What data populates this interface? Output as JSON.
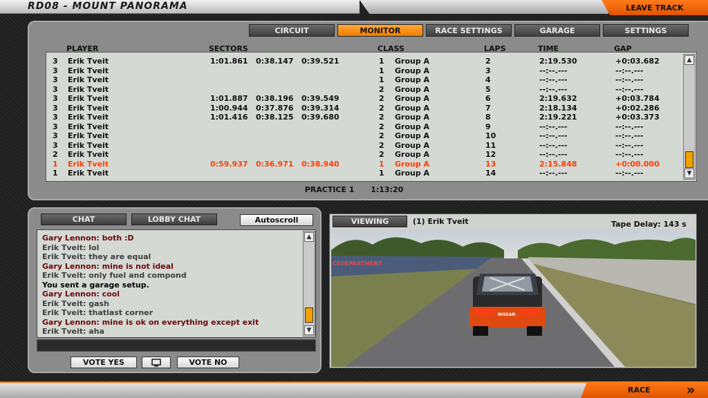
{
  "header": {
    "title": "RD08 - MOUNT PANORAMA",
    "leave_label": "LEAVE TRACK"
  },
  "tabs": [
    {
      "label": "CIRCUIT",
      "active": false
    },
    {
      "label": "MONITOR",
      "active": true
    },
    {
      "label": "RACE SETTINGS",
      "active": false
    },
    {
      "label": "GARAGE",
      "active": false
    },
    {
      "label": "SETTINGS",
      "active": false
    }
  ],
  "columns": {
    "player": "PLAYER",
    "sectors": "SECTORS",
    "class": "CLASS",
    "laps": "LAPS",
    "time": "TIME",
    "gap": "GAP"
  },
  "rows": [
    {
      "pos": "3",
      "player": "Erik Tveit",
      "s1": "1:01.861",
      "s2": "0:38.147",
      "s3": "0:39.521",
      "cls_no": "1",
      "cls": "Group A",
      "lap": "2",
      "time": "2:19.530",
      "gap": "+0:03.682",
      "hl": false
    },
    {
      "pos": "3",
      "player": "Erik Tveit",
      "s1": "",
      "s2": "",
      "s3": "",
      "cls_no": "1",
      "cls": "Group A",
      "lap": "3",
      "time": "--:--.---",
      "gap": "--:--.---",
      "hl": false
    },
    {
      "pos": "3",
      "player": "Erik Tveit",
      "s1": "",
      "s2": "",
      "s3": "",
      "cls_no": "1",
      "cls": "Group A",
      "lap": "4",
      "time": "--:--.---",
      "gap": "--:--.---",
      "hl": false
    },
    {
      "pos": "3",
      "player": "Erik Tveit",
      "s1": "",
      "s2": "",
      "s3": "",
      "cls_no": "2",
      "cls": "Group A",
      "lap": "5",
      "time": "--:--.---",
      "gap": "--:--.---",
      "hl": false
    },
    {
      "pos": "3",
      "player": "Erik Tveit",
      "s1": "1:01.887",
      "s2": "0:38.196",
      "s3": "0:39.549",
      "cls_no": "2",
      "cls": "Group A",
      "lap": "6",
      "time": "2:19.632",
      "gap": "+0:03.784",
      "hl": false
    },
    {
      "pos": "3",
      "player": "Erik Tveit",
      "s1": "1:00.944",
      "s2": "0:37.876",
      "s3": "0:39.314",
      "cls_no": "2",
      "cls": "Group A",
      "lap": "7",
      "time": "2:18.134",
      "gap": "+0:02.286",
      "hl": false
    },
    {
      "pos": "3",
      "player": "Erik Tveit",
      "s1": "1:01.416",
      "s2": "0:38.125",
      "s3": "0:39.680",
      "cls_no": "2",
      "cls": "Group A",
      "lap": "8",
      "time": "2:19.221",
      "gap": "+0:03.373",
      "hl": false
    },
    {
      "pos": "3",
      "player": "Erik Tveit",
      "s1": "",
      "s2": "",
      "s3": "",
      "cls_no": "2",
      "cls": "Group A",
      "lap": "9",
      "time": "--:--.---",
      "gap": "--:--.---",
      "hl": false
    },
    {
      "pos": "3",
      "player": "Erik Tveit",
      "s1": "",
      "s2": "",
      "s3": "",
      "cls_no": "2",
      "cls": "Group A",
      "lap": "10",
      "time": "--:--.---",
      "gap": "--:--.---",
      "hl": false
    },
    {
      "pos": "3",
      "player": "Erik Tveit",
      "s1": "",
      "s2": "",
      "s3": "",
      "cls_no": "2",
      "cls": "Group A",
      "lap": "11",
      "time": "--:--.---",
      "gap": "--:--.---",
      "hl": false
    },
    {
      "pos": "2",
      "player": "Erik Tveit",
      "s1": "",
      "s2": "",
      "s3": "",
      "cls_no": "2",
      "cls": "Group A",
      "lap": "12",
      "time": "--:--.---",
      "gap": "--:--.---",
      "hl": false
    },
    {
      "pos": "1",
      "player": "Erik Tveit",
      "s1": "0:59.937",
      "s2": "0:36.971",
      "s3": "0:38.940",
      "cls_no": "1",
      "cls": "Group A",
      "lap": "13",
      "time": "2:15.848",
      "gap": "+0:00.000",
      "hl": true
    },
    {
      "pos": "1",
      "player": "Erik Tveit",
      "s1": "",
      "s2": "",
      "s3": "",
      "cls_no": "1",
      "cls": "Group A",
      "lap": "14",
      "time": "--:--.---",
      "gap": "--:--.---",
      "hl": false
    }
  ],
  "session": {
    "label": "PRACTICE 1",
    "time": "1:13:20"
  },
  "chat": {
    "tab_chat": "CHAT",
    "tab_lobby": "LOBBY CHAT",
    "autoscroll": "Autoscroll",
    "messages": [
      {
        "text": "Gary Lennon: both   :D",
        "style": "red"
      },
      {
        "text": "Erik Tveit: lol",
        "style": "grey"
      },
      {
        "text": "Erik Tveit: they are equal",
        "style": "grey"
      },
      {
        "text": "Gary Lennon: mine is not ideal",
        "style": "red"
      },
      {
        "text": "Erik Tveit: only fuel and compond",
        "style": "grey"
      },
      {
        "text": "You sent a garage setup.",
        "style": "blk"
      },
      {
        "text": "Gary Lennon: cool",
        "style": "red"
      },
      {
        "text": "Erik Tveit: gash",
        "style": "grey"
      },
      {
        "text": "Erik Tveit: thatlast corner",
        "style": "grey"
      },
      {
        "text": "Gary Lennon: mine is ok on everything except exit",
        "style": "red"
      },
      {
        "text": "Erik Tveit: aha",
        "style": "grey"
      }
    ],
    "vote_yes": "VOTE YES",
    "vote_no": "VOTE NO"
  },
  "viewer": {
    "viewing_label": "VIEWING",
    "driver": "(1) Erik Tveit",
    "tape_delay": "Tape Delay: 143 s",
    "banner_text": "CEDEPARTMENT",
    "car_text": "NISSAN"
  },
  "footer": {
    "race_label": "RACE",
    "chevron": "»"
  },
  "colors": {
    "accent": "#f07d00",
    "highlight_row": "#ff3c00",
    "chat_name": "#6a0a0a"
  },
  "icons": [
    "monitor-icon",
    "chevron-up-icon",
    "chevron-down-icon",
    "double-chevron-right-icon"
  ]
}
